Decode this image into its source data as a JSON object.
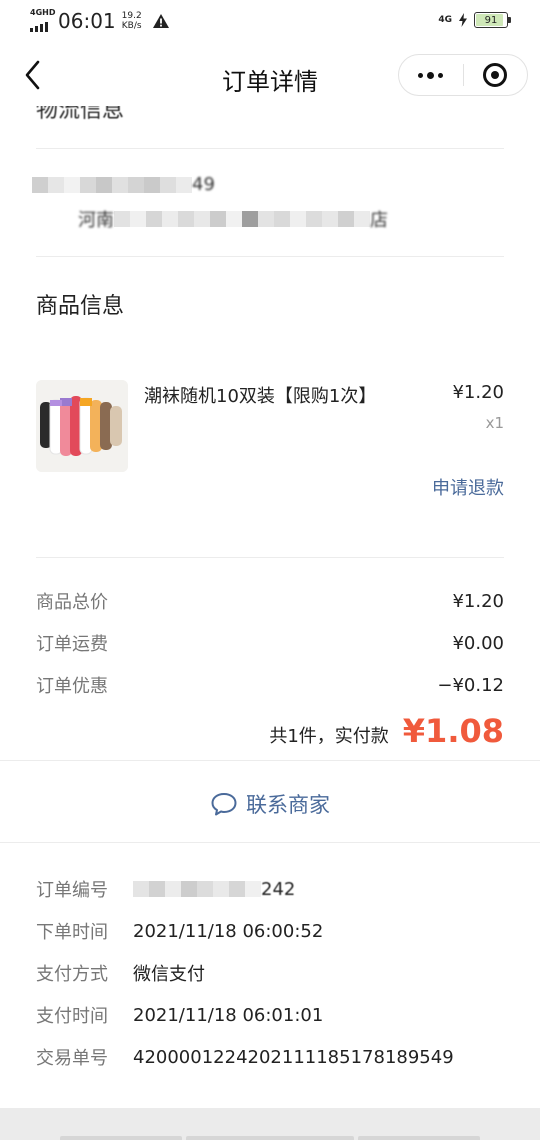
{
  "status_bar": {
    "network": "4GHD",
    "time": "06:01",
    "speed_value": "19.2",
    "speed_unit": "KB/s",
    "network_right": "4G",
    "battery": "91",
    "battery_level": 0.91
  },
  "nav": {
    "title": "订单详情"
  },
  "logistics": {
    "title": "物流信息",
    "contact_suffix": "49",
    "address_prefix": "河南",
    "address_suffix": "店"
  },
  "goods": {
    "section_title": "商品信息",
    "name": "潮袜随机10双装【限购1次】",
    "price": "¥1.20",
    "qty": "x1",
    "refund_label": "申请退款"
  },
  "summary": {
    "rows": [
      {
        "label": "商品总价",
        "value": "¥1.20"
      },
      {
        "label": "订单运费",
        "value": "¥0.00"
      },
      {
        "label": "订单优惠",
        "value": "−¥0.12"
      }
    ],
    "total_label": "共1件，实付款",
    "total_value": "¥1.08"
  },
  "contact": {
    "label": "联系商家"
  },
  "order_info": {
    "order_no_label": "订单编号",
    "order_no_suffix": "242",
    "rows": [
      {
        "label": "下单时间",
        "value": "2021/11/18 06:00:52"
      },
      {
        "label": "支付方式",
        "value": "微信支付"
      },
      {
        "label": "支付时间",
        "value": "2021/11/18 06:01:01"
      },
      {
        "label": "交易单号",
        "value": "4200001224202111185178189549"
      }
    ]
  },
  "colors": {
    "accent_red": "#f05a3c",
    "link_blue": "#4a6a9a",
    "muted_gray": "#777777"
  }
}
